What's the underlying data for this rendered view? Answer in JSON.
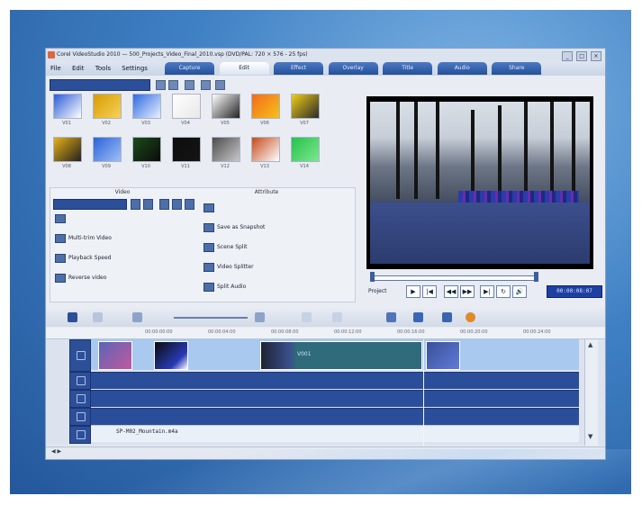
{
  "window": {
    "title": "Corel VideoStudio 2010 — 500_Projects_Video_Final_2010.vsp (DVD/PAL: 720 × 576 - 25 fps)",
    "min": "_",
    "max": "□",
    "close": "×"
  },
  "menu": [
    "File",
    "Edit",
    "Tools",
    "Settings"
  ],
  "step_tabs": [
    "Capture",
    "Edit",
    "Effect",
    "Overlay",
    "Title",
    "Audio",
    "Share"
  ],
  "active_step": "Edit",
  "library": {
    "category": "Video",
    "thumbs": [
      {
        "caption": "V01",
        "color1": "#2a5bd6",
        "color2": "#ffffff"
      },
      {
        "caption": "V02",
        "color1": "#d99b00",
        "color2": "#f6d25a"
      },
      {
        "caption": "V03",
        "color1": "#2d6ae0",
        "color2": "#e9f0ff"
      },
      {
        "caption": "V04",
        "color1": "#ffffff",
        "color2": "#e8e8e8"
      },
      {
        "caption": "V05",
        "color1": "#ffffff",
        "color2": "#222222"
      },
      {
        "caption": "V06",
        "color1": "#f36b1c",
        "color2": "#f6c21a"
      },
      {
        "caption": "V07",
        "color1": "#f0cd17",
        "color2": "#2a2a2a"
      },
      {
        "caption": "V08",
        "color1": "#e5b11c",
        "color2": "#23211d"
      },
      {
        "caption": "V09",
        "color1": "#2b62d8",
        "color2": "#9ec0f5"
      },
      {
        "caption": "V10",
        "color1": "#1b4b1b",
        "color2": "#0b0b0b"
      },
      {
        "caption": "V11",
        "color1": "#0d0d0d",
        "color2": "#141414"
      },
      {
        "caption": "V12",
        "color1": "#4c4c4c",
        "color2": "#c9c9c9"
      },
      {
        "caption": "V13",
        "color1": "#c54b1a",
        "color2": "#ffffff"
      },
      {
        "caption": "V14",
        "color1": "#24c24a",
        "color2": "#7de88f"
      }
    ]
  },
  "options": {
    "header_left": "Video",
    "header_right": "Attribute",
    "left_items": [
      "",
      "Multi-trim Video",
      "Playback Speed",
      "Reverse video"
    ],
    "right_items": [
      "",
      "Save as Snapshot",
      "Scene Split",
      "Video Splitter",
      "Split Audio"
    ]
  },
  "player": {
    "mode": "Project",
    "timecode": "00:00:08:07",
    "buttons": [
      "▶",
      "|◀",
      "◀◀",
      "▶▶",
      "▶|",
      "↻",
      "🔊"
    ]
  },
  "timeline": {
    "ruler": [
      "00:00:00:00",
      "00:00:04:00",
      "00:00:08:00",
      "00:00:12:00",
      "00:00:16:00",
      "00:00:20:00",
      "00:00:24:00",
      "00:00:28:00"
    ],
    "clip_label": "V001",
    "music_clip": "SP-M02_Mountain.m4a",
    "hscroll_label": "◀ ▶"
  },
  "colors": {
    "accent": "#2c4f9a",
    "preview_bg": "#000000",
    "timecode_bg": "#1d3fa0"
  }
}
